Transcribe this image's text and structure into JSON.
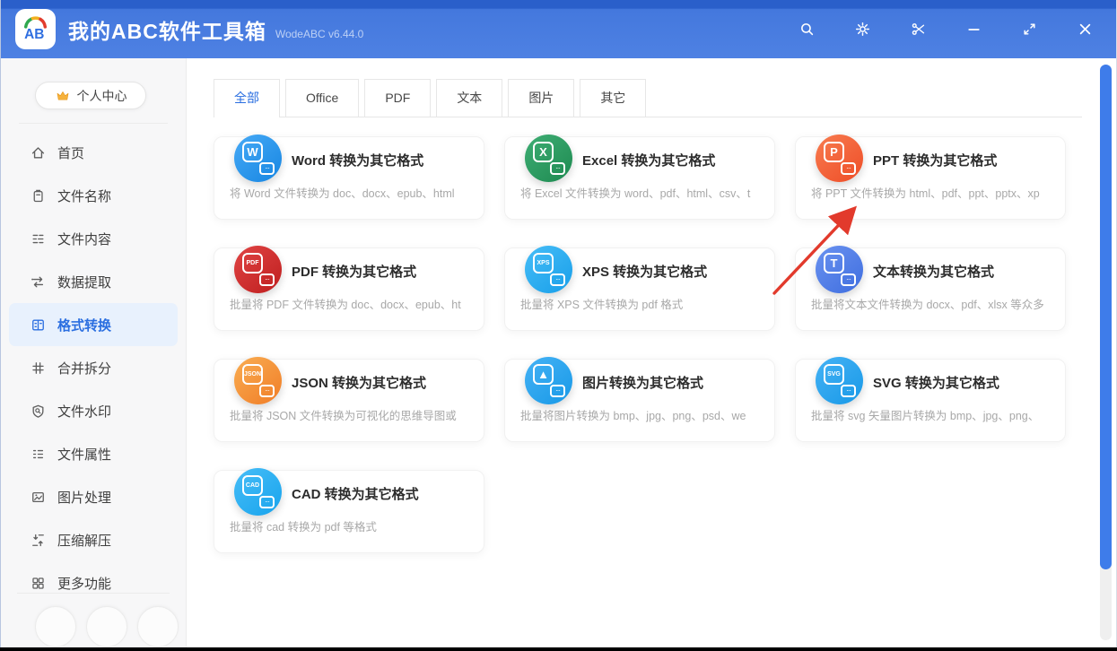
{
  "titlebar": {
    "logo_text": "AB",
    "app_title": "我的ABC软件工具箱",
    "version": "WodeABC v6.44.0",
    "actions": [
      {
        "name": "search-icon"
      },
      {
        "name": "settings-gear-icon"
      },
      {
        "name": "scissors-icon"
      },
      {
        "name": "minimize-icon"
      },
      {
        "name": "resize-icon"
      },
      {
        "name": "close-icon"
      }
    ]
  },
  "sidebar": {
    "personal_center": "个人中心",
    "items": [
      {
        "label": "首页",
        "icon": "home-icon",
        "active": false
      },
      {
        "label": "文件名称",
        "icon": "file-name-icon",
        "active": false
      },
      {
        "label": "文件内容",
        "icon": "file-content-icon",
        "active": false
      },
      {
        "label": "数据提取",
        "icon": "data-extract-icon",
        "active": false
      },
      {
        "label": "格式转换",
        "icon": "format-convert-icon",
        "active": true
      },
      {
        "label": "合并拆分",
        "icon": "merge-split-icon",
        "active": false
      },
      {
        "label": "文件水印",
        "icon": "watermark-icon",
        "active": false
      },
      {
        "label": "文件属性",
        "icon": "file-props-icon",
        "active": false
      },
      {
        "label": "图片处理",
        "icon": "image-process-icon",
        "active": false
      },
      {
        "label": "压缩解压",
        "icon": "compress-icon",
        "active": false
      },
      {
        "label": "更多功能",
        "icon": "more-grid-icon",
        "active": false
      }
    ]
  },
  "tabs": [
    {
      "label": "全部",
      "active": true
    },
    {
      "label": "Office",
      "active": false
    },
    {
      "label": "PDF",
      "active": false
    },
    {
      "label": "文本",
      "active": false
    },
    {
      "label": "图片",
      "active": false
    },
    {
      "label": "其它",
      "active": false
    }
  ],
  "cards": [
    {
      "icon_text": "W",
      "c1": "#47aaf6",
      "c2": "#1786e2",
      "title": "Word 转换为其它格式",
      "desc": "将 Word 文件转换为 doc、docx、epub、html"
    },
    {
      "icon_text": "X",
      "c1": "#3fae74",
      "c2": "#1e8a51",
      "title": "Excel 转换为其它格式",
      "desc": "将 Excel 文件转换为 word、pdf、html、csv、t"
    },
    {
      "icon_text": "P",
      "c1": "#f87c50",
      "c2": "#ee4d27",
      "title": "PPT 转换为其它格式",
      "desc": "将 PPT 文件转换为 html、pdf、ppt、pptx、xp"
    },
    {
      "icon_text": "PDF",
      "c1": "#e04444",
      "c2": "#bf1f1f",
      "title": "PDF 转换为其它格式",
      "desc": "批量将 PDF 文件转换为 doc、docx、epub、ht"
    },
    {
      "icon_text": "XPS",
      "c1": "#47bdf7",
      "c2": "#189fe9",
      "title": "XPS 转换为其它格式",
      "desc": "批量将 XPS 文件转换为 pdf 格式"
    },
    {
      "icon_text": "T",
      "c1": "#6a92f0",
      "c2": "#3f6edf",
      "title": "文本转换为其它格式",
      "desc": "批量将文本文件转换为 docx、pdf、xlsx 等众多"
    },
    {
      "icon_text": "JSON",
      "c1": "#f9ad52",
      "c2": "#f07d27",
      "title": "JSON 转换为其它格式",
      "desc": "批量将 JSON 文件转换为可视化的思维导图或"
    },
    {
      "icon_text": "▲",
      "c1": "#45b2f5",
      "c2": "#1899e7",
      "title": "图片转换为其它格式",
      "desc": "批量将图片转换为 bmp、jpg、png、psd、we"
    },
    {
      "icon_text": "SVG",
      "c1": "#45b2f5",
      "c2": "#1899e7",
      "title": "SVG 转换为其它格式",
      "desc": "批量将 svg 矢量图片转换为 bmp、jpg、png、"
    },
    {
      "icon_text": "CAD",
      "c1": "#47bdf7",
      "c2": "#18a4ed",
      "title": "CAD 转换为其它格式",
      "desc": "批量将 cad 转换为 pdf 等格式"
    }
  ],
  "annotation": {
    "type": "red-arrow",
    "color": "#e23a2c",
    "points_at": "PPT 转换为其它格式"
  },
  "colors": {
    "accent": "#2a6ee0",
    "titlebar": "#4478dd",
    "scrollbar_thumb": "#3e7cea",
    "sidebar_bg": "#f7f7f8"
  }
}
